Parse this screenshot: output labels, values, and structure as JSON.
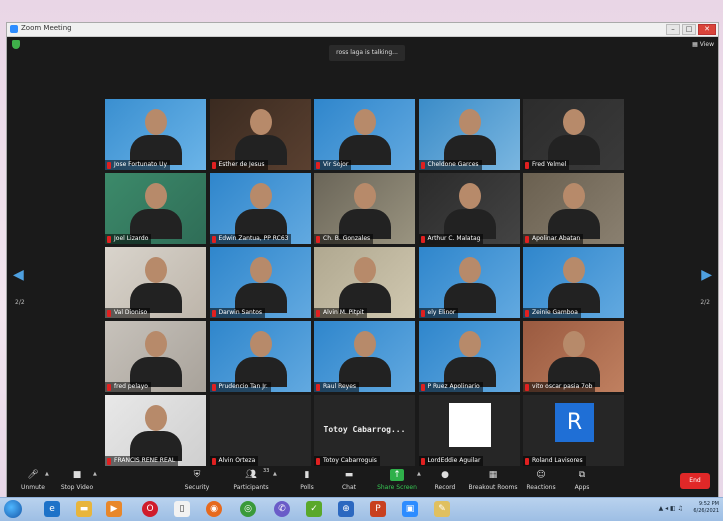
{
  "window": {
    "title": "Zoom Meeting",
    "talking_indicator": "ross laga is talking...",
    "view_label": "View",
    "page_left": "2/2",
    "page_right": "2/2"
  },
  "participants": [
    {
      "name": "Jose Fortunato Uy",
      "speaking": false
    },
    {
      "name": "Esther de Jesus",
      "speaking": false
    },
    {
      "name": "Vir Sojor",
      "speaking": false
    },
    {
      "name": "Cheldone Garces",
      "speaking": false
    },
    {
      "name": "Fred Yelmel",
      "speaking": false
    },
    {
      "name": "Joel Lizardo",
      "speaking": false
    },
    {
      "name": "Edwin Zantua, PP RC63",
      "speaking": false
    },
    {
      "name": "Ch. B. Gonzales",
      "speaking": false
    },
    {
      "name": "Arthur C. Malatag",
      "speaking": false
    },
    {
      "name": "Apolinar Abatan",
      "speaking": false
    },
    {
      "name": "Val Dioniso",
      "speaking": false
    },
    {
      "name": "Darwin Santos",
      "speaking": false
    },
    {
      "name": "Alvin M. Pitpit",
      "speaking": false
    },
    {
      "name": "ely Elinor",
      "speaking": false
    },
    {
      "name": "Zeinie Gamboa",
      "speaking": false
    },
    {
      "name": "fred pelayo",
      "speaking": false
    },
    {
      "name": "Prudencio Tan Jr.",
      "speaking": false
    },
    {
      "name": "Raul Reyes",
      "speaking": false
    },
    {
      "name": "P Ruez Apolinario",
      "speaking": false
    },
    {
      "name": "vito oscar pasia 7ob",
      "speaking": false
    },
    {
      "name": "FRANCIS RENE REAL",
      "speaking": false
    },
    {
      "name": "Alvin Orteza",
      "speaking": false
    },
    {
      "name": "Totoy Cabarroguis",
      "speaking": false,
      "display": "Totoy  Cabarrog..."
    },
    {
      "name": "LordEddie Aguilar",
      "speaking": false
    },
    {
      "name": "Roland Lavisores",
      "speaking": false,
      "avatar_letter": "R"
    }
  ],
  "toolbar": {
    "unmute": "Unmute",
    "stop_video": "Stop Video",
    "security": "Security",
    "participants": "Participants",
    "participants_count": "33",
    "polls": "Polls",
    "chat": "Chat",
    "share_screen": "Share Screen",
    "record": "Record",
    "breakout_rooms": "Breakout Rooms",
    "reactions": "Reactions",
    "apps": "Apps",
    "end": "End"
  },
  "taskbar": {
    "time": "9:52 PM",
    "date": "6/26/2021"
  },
  "colors": {
    "accent": "#2d8cff",
    "share": "#37c954",
    "end": "#e02828",
    "mute": "#e02020"
  }
}
